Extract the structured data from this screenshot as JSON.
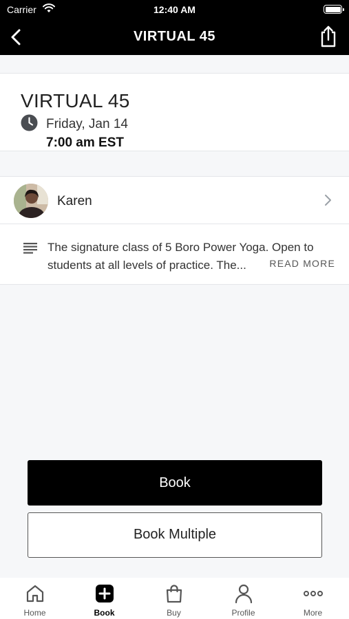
{
  "status_bar": {
    "carrier": "Carrier",
    "time": "12:40 AM"
  },
  "nav": {
    "title": "VIRTUAL 45"
  },
  "class": {
    "name": "VIRTUAL 45",
    "date": "Friday, Jan 14",
    "time": "7:00 am EST"
  },
  "instructor": {
    "name": "Karen"
  },
  "description": {
    "text": "The signature class of 5 Boro Power Yoga. Open to students at all levels of practice. The...",
    "read_more": "READ MORE"
  },
  "actions": {
    "book": "Book",
    "book_multiple": "Book Multiple"
  },
  "tabs": [
    {
      "label": "Home",
      "icon": "home-icon"
    },
    {
      "label": "Book",
      "icon": "plus-square-icon"
    },
    {
      "label": "Buy",
      "icon": "shopping-bag-icon"
    },
    {
      "label": "Profile",
      "icon": "person-icon"
    },
    {
      "label": "More",
      "icon": "more-dots-icon"
    }
  ],
  "colors": {
    "primary": "#000000",
    "background": "#f6f7f9",
    "card": "#ffffff"
  }
}
